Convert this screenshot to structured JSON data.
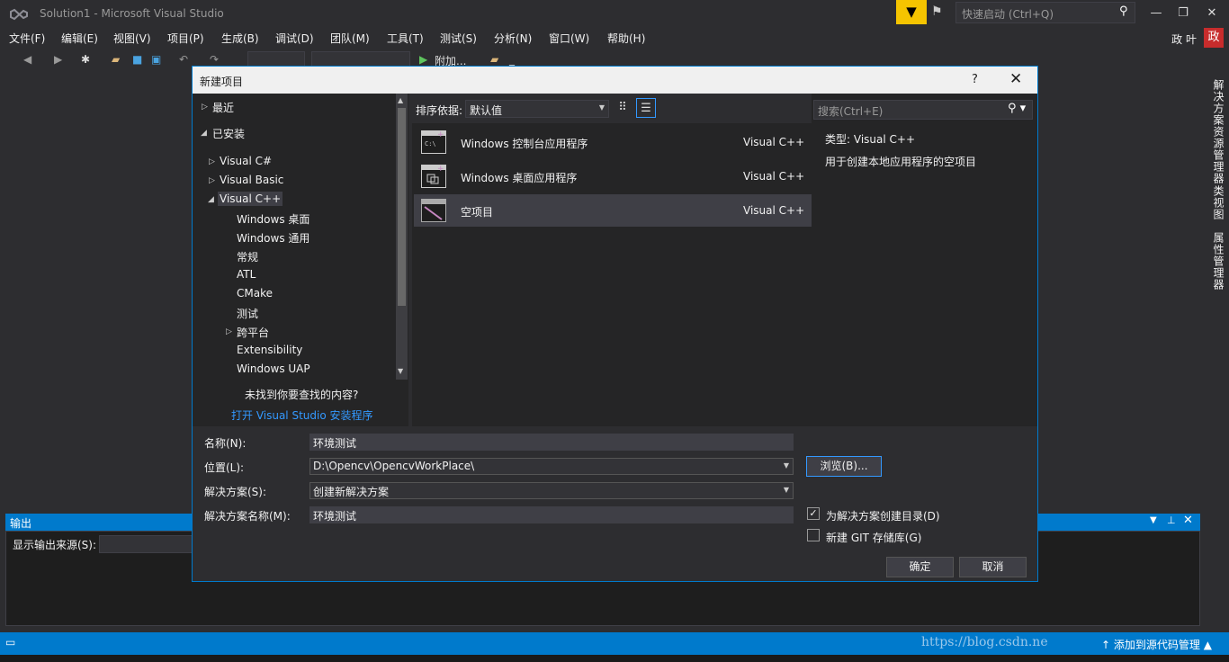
{
  "window": {
    "title": "Solution1 - Microsoft Visual Studio",
    "quick_launch_placeholder": "快速启动 (Ctrl+Q)"
  },
  "menu": [
    "文件(F)",
    "编辑(E)",
    "视图(V)",
    "项目(P)",
    "生成(B)",
    "调试(D)",
    "团队(M)",
    "工具(T)",
    "测试(S)",
    "分析(N)",
    "窗口(W)",
    "帮助(H)"
  ],
  "user": {
    "name": "政 叶",
    "avatar_initial": "政"
  },
  "toolbar": {
    "attach_label": "附加...",
    "extra": "_"
  },
  "side_tabs": [
    "解决方案资源管理器",
    "类视图",
    "属性管理器"
  ],
  "output": {
    "title": "输出",
    "source_label": "显示输出来源(S):"
  },
  "status": {
    "watermark": "https://blog.csdn.ne",
    "right": "添加到源代码管理"
  },
  "dialog": {
    "title": "新建项目",
    "help": "?",
    "tree": {
      "recent": "最近",
      "installed": "已安装",
      "items": [
        "Visual C#",
        "Visual Basic",
        "Visual C++"
      ],
      "cpp_children": [
        "Windows 桌面",
        "Windows 通用",
        "常规",
        "ATL",
        "CMake",
        "测试",
        "跨平台",
        "Extensibility",
        "Windows UAP"
      ],
      "not_found": "未找到你要查找的内容?",
      "installer_link": "打开 Visual Studio 安装程序"
    },
    "sort": {
      "label": "排序依据:",
      "value": "默认值"
    },
    "search_placeholder": "搜索(Ctrl+E)",
    "templates": [
      {
        "name": "Windows 控制台应用程序",
        "lang": "Visual C++",
        "icon": "console-app-icon"
      },
      {
        "name": "Windows 桌面应用程序",
        "lang": "Visual C++",
        "icon": "desktop-app-icon"
      },
      {
        "name": "空项目",
        "lang": "Visual C++",
        "icon": "empty-project-icon"
      }
    ],
    "details": {
      "type_label": "类型:",
      "type_value": "Visual C++",
      "description": "用于创建本地应用程序的空项目"
    },
    "form": {
      "name_label": "名称(N):",
      "name_value": "环境测试",
      "location_label": "位置(L):",
      "location_value": "D:\\Opencv\\OpencvWorkPlace\\",
      "solution_label": "解决方案(S):",
      "solution_value": "创建新解决方案",
      "solution_name_label": "解决方案名称(M):",
      "solution_name_value": "环境测试",
      "browse": "浏览(B)...",
      "create_dir": "为解决方案创建目录(D)",
      "create_dir_checked": true,
      "git": "新建 GIT 存储库(G)",
      "git_checked": false,
      "ok": "确定",
      "cancel": "取消"
    }
  }
}
